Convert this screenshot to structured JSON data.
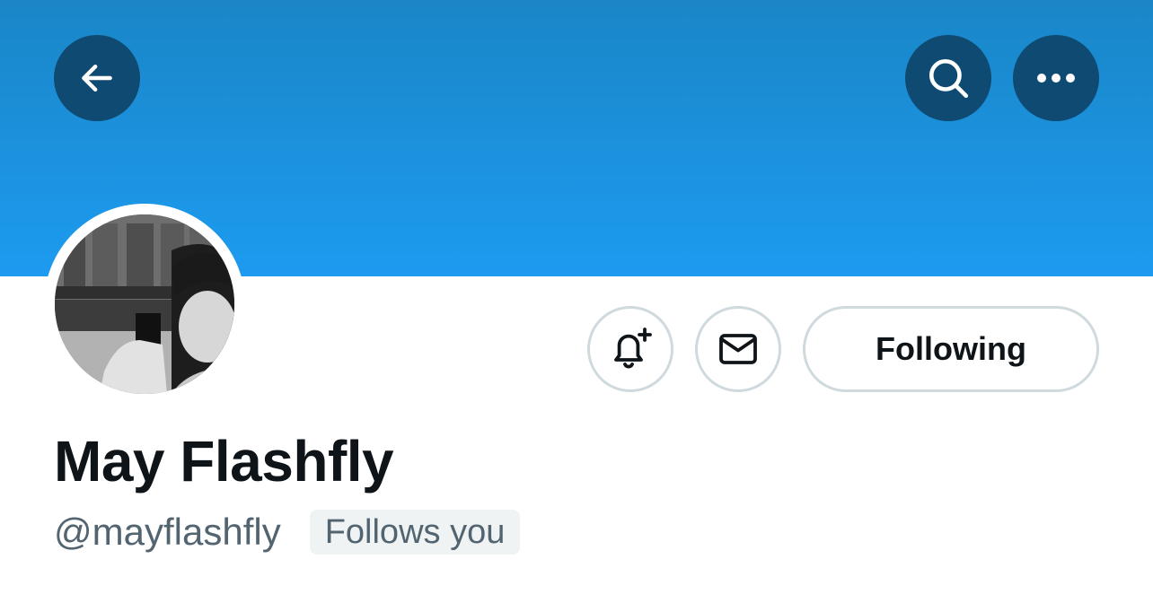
{
  "header": {
    "back_icon": "arrow-left-icon",
    "search_icon": "search-icon",
    "more_icon": "more-dots-icon",
    "banner_color": "#1d9bf0",
    "button_color": "#0f4a72"
  },
  "profile": {
    "display_name": "May Flashfly",
    "handle": "@mayflashfly",
    "follows_you_label": "Follows you",
    "avatar_icon": "profile-photo"
  },
  "actions": {
    "notify_icon": "bell-plus-icon",
    "message_icon": "envelope-icon",
    "following_label": "Following"
  }
}
